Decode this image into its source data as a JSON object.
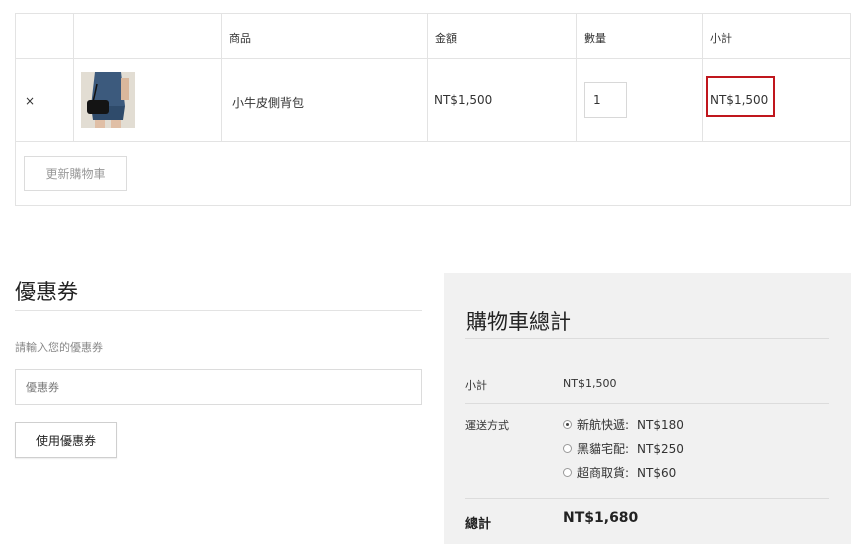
{
  "cart": {
    "headers": {
      "product": "商品",
      "price": "金額",
      "quantity": "數量",
      "subtotal": "小計"
    },
    "remove_label": "×",
    "item": {
      "name": "小牛皮側背包",
      "price": "NT$1,500",
      "quantity": "1",
      "subtotal": "NT$1,500",
      "image_icon": "product-thumbnail"
    },
    "update_label": "更新購物車",
    "highlight_color": "#c0161d"
  },
  "coupon": {
    "title": "優惠券",
    "hint": "請輸入您的優惠券",
    "placeholder": "優惠券",
    "apply_label": "使用優惠券"
  },
  "totals": {
    "title": "購物車總計",
    "subtotal_label": "小計",
    "subtotal_value": "NT$1,500",
    "shipping_label": "運送方式",
    "shipping_options": [
      {
        "name": "新航快遞:",
        "price": "NT$180",
        "selected": true
      },
      {
        "name": "黑貓宅配:",
        "price": "NT$250",
        "selected": false
      },
      {
        "name": "超商取貨:",
        "price": "NT$60",
        "selected": false
      }
    ],
    "total_label": "總計",
    "total_value": "NT$1,680"
  }
}
